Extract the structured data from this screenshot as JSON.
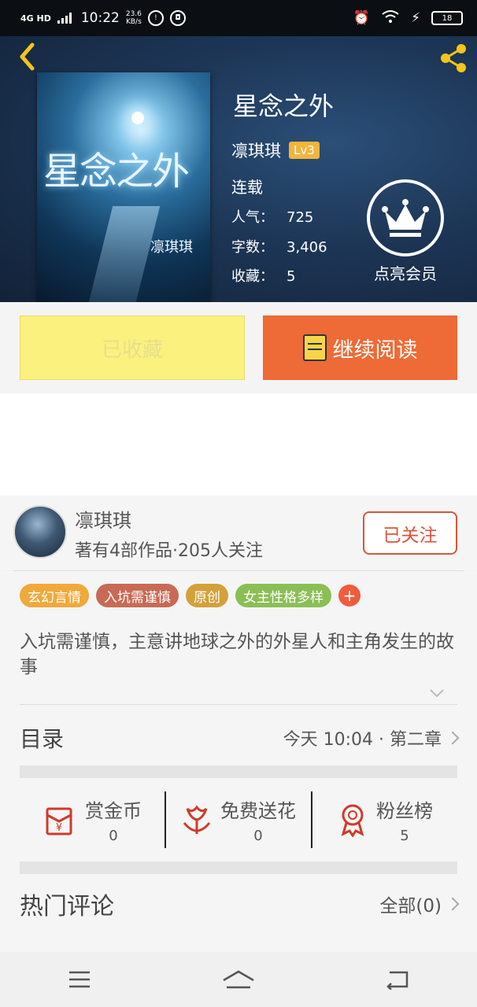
{
  "status_bar": {
    "network": "4G HD",
    "time": "10:22",
    "speed_value": "23.6",
    "speed_unit": "KB/s",
    "battery": "18"
  },
  "book": {
    "title": "星念之外",
    "author": "凛琪琪",
    "level": "Lv3",
    "status": "连载",
    "popularity_label": "人气：",
    "popularity": "725",
    "words_label": "字数：",
    "words": "3,406",
    "favorites_label": "收藏：",
    "favorites": "5",
    "cover_title": "星念之外",
    "cover_author": "凛琪琪",
    "vip_label": "点亮会员"
  },
  "actions": {
    "collected_label": "已收藏",
    "read_label": "继续阅读"
  },
  "author_card": {
    "name": "凛琪琪",
    "works": "著有4部作品·205人关注",
    "follow_label": "已关注"
  },
  "tags": [
    {
      "label": "玄幻言情",
      "color": "#f0a93a"
    },
    {
      "label": "入坑需谨慎",
      "color": "#c86a55"
    },
    {
      "label": "原创",
      "color": "#d3a13a"
    },
    {
      "label": "女主性格多样",
      "color": "#8bbf55"
    }
  ],
  "tag_plus": "+",
  "synopsis": "入坑需谨慎，主意讲地球之外的外星人和主角发生的故事",
  "toc": {
    "title": "目录",
    "latest": "今天 10:04 · 第二章"
  },
  "rewards": [
    {
      "label": "赏金币",
      "count": "0",
      "icon": "red-envelope-icon"
    },
    {
      "label": "免费送花",
      "count": "0",
      "icon": "flower-icon"
    },
    {
      "label": "粉丝榜",
      "count": "5",
      "icon": "medal-icon"
    }
  ],
  "comments": {
    "title": "热门评论",
    "all_label": "全部(0)"
  },
  "colors": {
    "accent_orange": "#ee6a36",
    "collected_yellow": "#fbf17f",
    "follow_red": "#d9553b",
    "level_gold": "#f2b53d",
    "header_icon_gold": "#f5c518"
  }
}
